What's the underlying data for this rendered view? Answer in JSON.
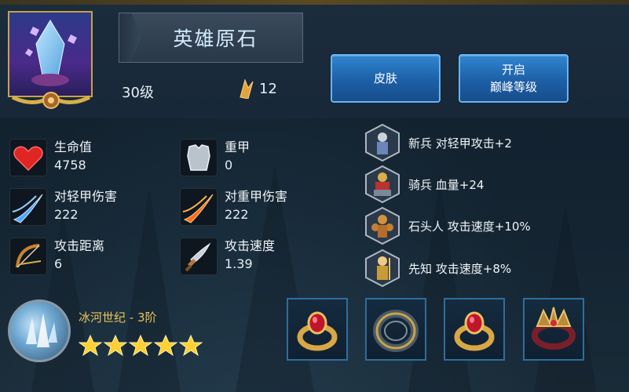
{
  "hero": {
    "name": "英雄原石",
    "level_text": "30级",
    "token_count": "12"
  },
  "buttons": {
    "skin": "皮肤",
    "peak_line1": "开启",
    "peak_line2": "巅峰等级"
  },
  "stats": [
    {
      "label": "生命值",
      "value": "4758",
      "icon": "heart-icon"
    },
    {
      "label": "重甲",
      "value": "0",
      "icon": "armor-icon"
    },
    {
      "label": "对轻甲伤害",
      "value": "222",
      "icon": "light-damage-icon"
    },
    {
      "label": "对重甲伤害",
      "value": "222",
      "icon": "heavy-damage-icon"
    },
    {
      "label": "攻击距离",
      "value": "6",
      "icon": "bow-icon"
    },
    {
      "label": "攻击速度",
      "value": "1.39",
      "icon": "dagger-icon"
    }
  ],
  "bonuses": [
    {
      "text": "新兵 对轻甲攻击+2",
      "icon": "recruit-icon"
    },
    {
      "text": "骑兵 血量+24",
      "icon": "knight-icon"
    },
    {
      "text": "石头人 攻击速度+10%",
      "icon": "golem-icon"
    },
    {
      "text": "先知 攻击速度+8%",
      "icon": "prophet-icon"
    }
  ],
  "enchantment": {
    "name": "冰河世纪 - 3阶",
    "stars": 5
  },
  "items": [
    "ruby-ring-icon",
    "steel-ring-icon",
    "ruby-ring-icon",
    "crown-ring-icon"
  ],
  "colors": {
    "button_blue": "#1d5fa6",
    "gold": "#e9c55b",
    "item_border": "#2f6d9c"
  }
}
